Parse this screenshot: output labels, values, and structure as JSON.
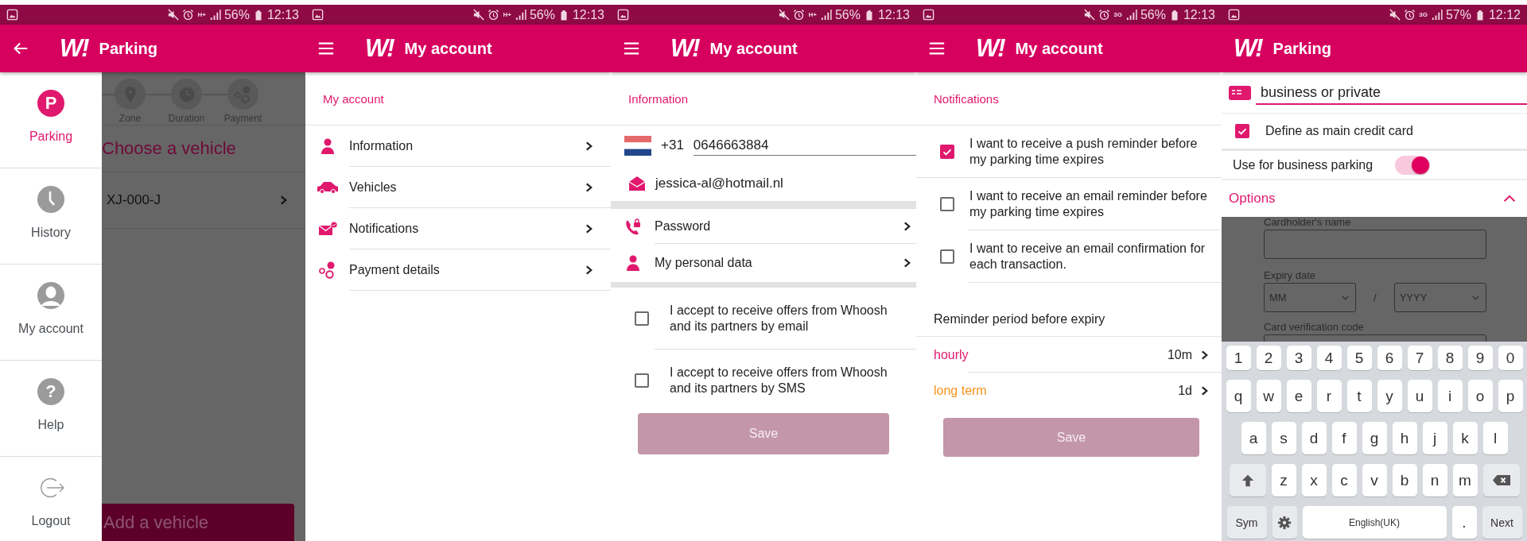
{
  "screens": [
    {
      "kind": "drawer",
      "status_bar": {
        "network": "H+",
        "battery": "56%",
        "time": "12:13"
      },
      "app_bar": {
        "nav": {
          "kind": "back"
        },
        "logo": "W!",
        "title": "Parking"
      },
      "drawer": [
        {
          "kind": "parking",
          "glyph": "P",
          "label": "Parking",
          "selected": true
        },
        {
          "kind": "history",
          "label": "History",
          "selected": false
        },
        {
          "kind": "account",
          "label": "My account",
          "selected": false
        },
        {
          "kind": "help",
          "glyph": "?",
          "label": "Help",
          "selected": false
        },
        {
          "kind": "logout",
          "label": "Logout",
          "selected": false
        }
      ],
      "background": {
        "steps": [
          {
            "kind": "zone",
            "label": "Zone"
          },
          {
            "kind": "duration",
            "label": "Duration"
          },
          {
            "kind": "payment",
            "label": "Payment"
          }
        ],
        "heading": "Choose a vehicle",
        "vehicles": [
          {
            "plate": "XJ-000-J"
          }
        ],
        "button": "Add a vehicle"
      }
    },
    {
      "kind": "menu",
      "status_bar": {
        "network": "H+",
        "battery": "56%",
        "time": "12:13"
      },
      "app_bar": {
        "nav": {
          "kind": "menu"
        },
        "logo": "W!",
        "title": "My account"
      },
      "section_title": "My account",
      "items": [
        {
          "kind": "person",
          "label": "Information"
        },
        {
          "kind": "car",
          "label": "Vehicles"
        },
        {
          "kind": "mail",
          "label": "Notifications"
        },
        {
          "kind": "coins",
          "label": "Payment details"
        }
      ]
    },
    {
      "kind": "information",
      "status_bar": {
        "network": "H+",
        "battery": "56%",
        "time": "12:13"
      },
      "app_bar": {
        "nav": {
          "kind": "menu"
        },
        "logo": "W!",
        "title": "My account"
      },
      "section_title": "Information",
      "phone": {
        "country_code": "+31",
        "value": "0646663884"
      },
      "email": "jessica-al@hotmail.nl",
      "links": [
        {
          "kind": "password",
          "label": "Password"
        },
        {
          "kind": "person",
          "label": "My personal data"
        }
      ],
      "consents": [
        {
          "label": "I accept to receive offers from Whoosh and its partners by email",
          "checked": false
        },
        {
          "label": "I accept to receive offers from Whoosh and its partners by SMS",
          "checked": false
        }
      ],
      "save_button": {
        "label": "Save",
        "disabled": true
      }
    },
    {
      "kind": "notifications",
      "status_bar": {
        "network": "3G",
        "battery": "56%",
        "time": "12:13"
      },
      "app_bar": {
        "nav": {
          "kind": "menu"
        },
        "logo": "W!",
        "title": "My account"
      },
      "section_title": "Notifications",
      "options": [
        {
          "label": "I want to receive a push reminder before my parking time expires",
          "checked": true
        },
        {
          "label": "I want to receive an email reminder before my parking time expires",
          "checked": false
        },
        {
          "label": "I want to receive an email confirmation for each transaction.",
          "checked": false
        }
      ],
      "reminder_title": "Reminder period before expiry",
      "periods": [
        {
          "label": "hourly",
          "value": "10m",
          "color": "#e0196e"
        },
        {
          "label": "long term",
          "value": "1d",
          "color": "#f7931e"
        }
      ],
      "save_button": {
        "label": "Save",
        "disabled": true
      }
    },
    {
      "kind": "payment",
      "status_bar": {
        "network": "3G",
        "battery": "57%",
        "time": "12:12"
      },
      "app_bar": {
        "logo": "W!",
        "title": "Parking"
      },
      "card_name": {
        "value": "business or private"
      },
      "main_card": {
        "label": "Define as main credit card",
        "checked": true
      },
      "business_parking": {
        "label": "Use for business parking",
        "on": true
      },
      "options": {
        "label": "Options",
        "expanded": true
      },
      "card_form": {
        "cardholder_label": "Cardholder's name",
        "expiry_label": "Expiry date",
        "month": "MM",
        "separator": "/",
        "year": "YYYY",
        "cvc_label": "Card verification code"
      },
      "keyboard": {
        "rows": [
          {
            "keys": [
              {
                "kind": "char",
                "label": "1"
              },
              {
                "kind": "char",
                "label": "2"
              },
              {
                "kind": "char",
                "label": "3"
              },
              {
                "kind": "char",
                "label": "4"
              },
              {
                "kind": "char",
                "label": "5"
              },
              {
                "kind": "char",
                "label": "6"
              },
              {
                "kind": "char",
                "label": "7"
              },
              {
                "kind": "char",
                "label": "8"
              },
              {
                "kind": "char",
                "label": "9"
              },
              {
                "kind": "char",
                "label": "0"
              }
            ]
          },
          {
            "keys": [
              {
                "kind": "char",
                "label": "q"
              },
              {
                "kind": "char",
                "label": "w"
              },
              {
                "kind": "char",
                "label": "e"
              },
              {
                "kind": "char",
                "label": "r"
              },
              {
                "kind": "char",
                "label": "t"
              },
              {
                "kind": "char",
                "label": "y"
              },
              {
                "kind": "char",
                "label": "u"
              },
              {
                "kind": "char",
                "label": "i"
              },
              {
                "kind": "char",
                "label": "o"
              },
              {
                "kind": "char",
                "label": "p"
              }
            ]
          },
          {
            "keys": [
              {
                "kind": "char",
                "label": "a"
              },
              {
                "kind": "char",
                "label": "s"
              },
              {
                "kind": "char",
                "label": "d"
              },
              {
                "kind": "char",
                "label": "f"
              },
              {
                "kind": "char",
                "label": "g"
              },
              {
                "kind": "char",
                "label": "h"
              },
              {
                "kind": "char",
                "label": "j"
              },
              {
                "kind": "char",
                "label": "k"
              },
              {
                "kind": "char",
                "label": "l"
              }
            ]
          },
          {
            "keys": [
              {
                "kind": "shift"
              },
              {
                "kind": "char",
                "label": "z"
              },
              {
                "kind": "char",
                "label": "x"
              },
              {
                "kind": "char",
                "label": "c"
              },
              {
                "kind": "char",
                "label": "v"
              },
              {
                "kind": "char",
                "label": "b"
              },
              {
                "kind": "char",
                "label": "n"
              },
              {
                "kind": "char",
                "label": "m"
              },
              {
                "kind": "backspace"
              }
            ]
          },
          {
            "keys": [
              {
                "kind": "function",
                "label": "Sym"
              },
              {
                "kind": "settings"
              },
              {
                "kind": "space",
                "label": "English(UK)"
              },
              {
                "kind": "char",
                "label": "."
              },
              {
                "kind": "function",
                "label": "Next"
              }
            ]
          }
        ]
      }
    }
  ]
}
